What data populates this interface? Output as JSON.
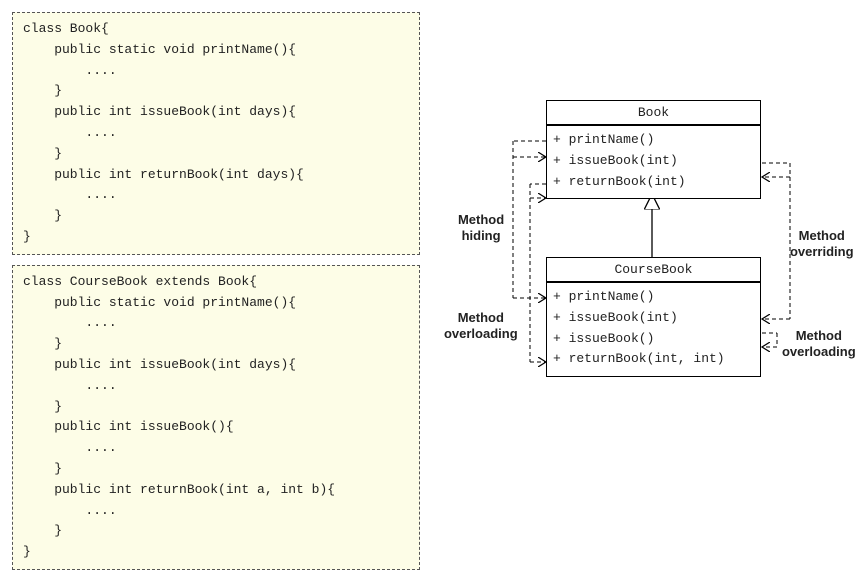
{
  "code": {
    "book": "class Book{\n    public static void printName(){\n        ....\n    }\n    public int issueBook(int days){\n        ....\n    }\n    public int returnBook(int days){\n        ....\n    }\n}",
    "courseBook": "class CourseBook extends Book{\n    public static void printName(){\n        ....\n    }\n    public int issueBook(int days){\n        ....\n    }\n    public int issueBook(){\n        ....\n    }\n    public int returnBook(int a, int b){\n        ....\n    }\n}"
  },
  "uml": {
    "book": {
      "title": "Book",
      "methods": [
        "+ printName()",
        "+ issueBook(int)",
        "+ returnBook(int)"
      ]
    },
    "courseBook": {
      "title": "CourseBook",
      "methods": [
        "+ printName()",
        "+ issueBook(int)",
        "+ issueBook()",
        "+ returnBook(int, int)"
      ]
    }
  },
  "labels": {
    "hiding": "Method\nhiding",
    "overriding": "Method\noverriding",
    "overloadingLeft": "Method\noverloading",
    "overloadingRight": "Method\noverloading"
  }
}
